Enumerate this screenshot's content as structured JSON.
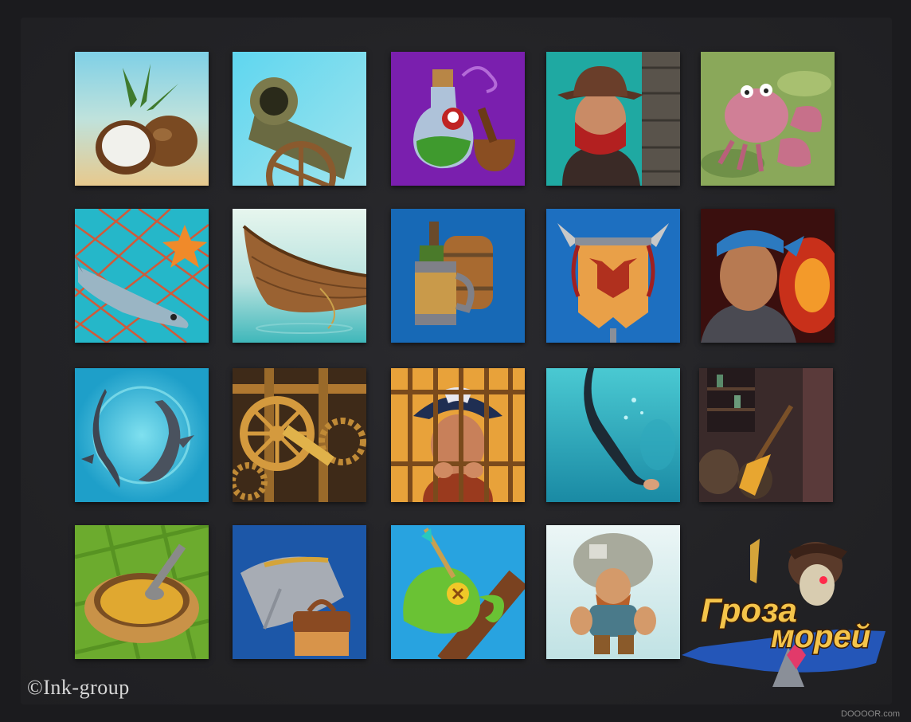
{
  "credit": "©Ink-group",
  "watermark": "DOOOOR.com",
  "logo": {
    "line1": "Гроза",
    "line2": "морей"
  },
  "icons": [
    "coconut-icon",
    "cannon-icon",
    "poison-potion-icon",
    "masked-bandit-icon",
    "crab-icon",
    "fish-net-starfish-icon",
    "wooden-boat-icon",
    "rum-bottle-mug-icon",
    "bull-banner-icon",
    "sailor-bandana-icon",
    "sharks-icon",
    "gear-mechanism-icon",
    "caged-captain-icon",
    "diver-icon",
    "broom-barrels-icon",
    "soup-bowl-icon",
    "armor-brush-icon",
    "chameleon-arrow-icon",
    "porter-carrying-sack-icon"
  ]
}
